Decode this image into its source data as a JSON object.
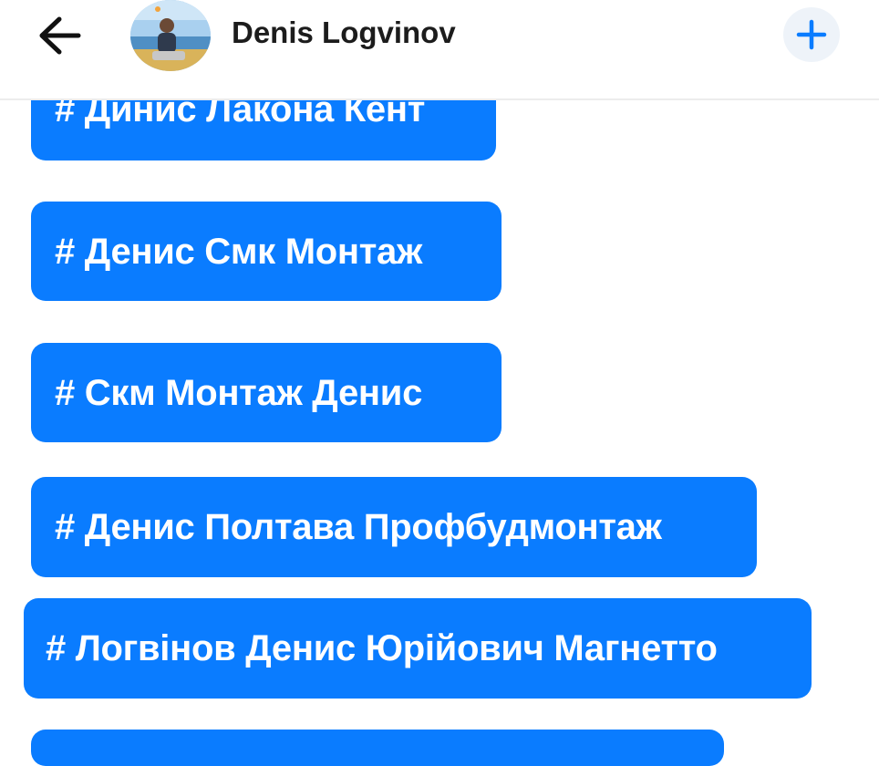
{
  "header": {
    "back_icon": "arrow-left-icon",
    "profile_name": "Denis Logvinov",
    "add_icon": "plus-icon",
    "accent": "#0a7cff"
  },
  "tags": [
    {
      "label": "# Динис Лакона Кент"
    },
    {
      "label": "# Денис Смк Монтаж"
    },
    {
      "label": "# Скм Монтаж Денис"
    },
    {
      "label": "# Денис Полтава Профбудмонтаж"
    },
    {
      "label": "# Логвінов Денис Юрійович Магнетто"
    }
  ],
  "tag_color": "#0a7cff"
}
